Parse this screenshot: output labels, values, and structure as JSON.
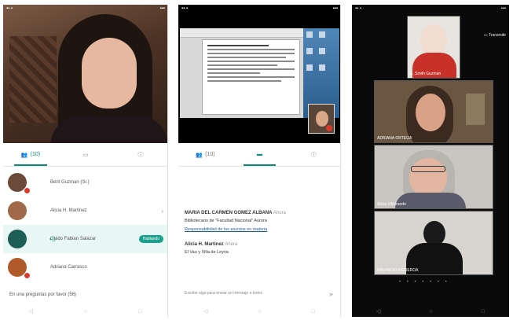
{
  "phone1": {
    "tabs": {
      "participants": "(10)"
    },
    "participants": [
      {
        "name": "Berit Guzman (Sr.)",
        "avatar_color": "#6c4a3a"
      },
      {
        "name": "Alicia H. Martinez",
        "avatar_color": "#a06a4a"
      },
      {
        "name": "Guido Fabian Salazar",
        "avatar_color": "#1d5e57",
        "tag": "Hablando"
      },
      {
        "name": "Adriana Carrasco",
        "avatar_color": "#b05a2a"
      }
    ],
    "footer": "En una preguntas por favor (56)"
  },
  "phone2": {
    "tabs": {
      "participants": "(10)"
    },
    "chat": [
      {
        "author": "MARIA DEL CARMEN GOMEZ ALBANA",
        "time": "Ahora",
        "body": "Bibliotecario de \"Facultad Nacional\" Aurora",
        "link": "Responsabilidad de los asuntos en materia"
      },
      {
        "author": "Alicia H. Martinez",
        "time": "Ahora",
        "body": "El Vau y Villa de Leyva"
      }
    ],
    "input_placeholder": "Escribe algo para enviar un mensaje a todos"
  },
  "phone3": {
    "cast_label": "Transmitir",
    "tiles": [
      {
        "label": "E. Smith Guzman"
      },
      {
        "label": "ADRIANA ORTEGA"
      },
      {
        "label": "Alicia Villafrando"
      },
      {
        "label": "MAURICIO FIGUEROA"
      }
    ],
    "page_dots": "• • • • • • •"
  },
  "colors": {
    "accent": "#0a8a7a",
    "alert": "#d83b2b"
  }
}
